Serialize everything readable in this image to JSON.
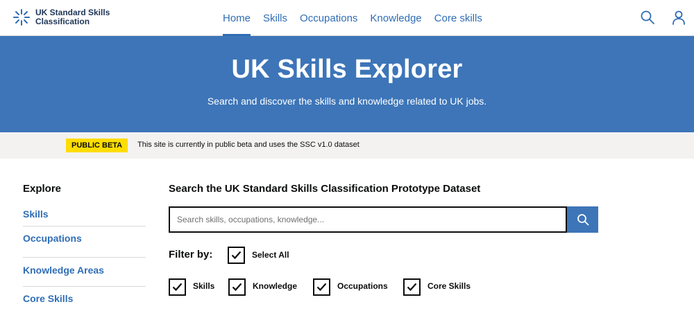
{
  "header": {
    "logo_text": "UK Standard Skills Classification",
    "nav": [
      {
        "label": "Home",
        "active": true
      },
      {
        "label": "Skills",
        "active": false
      },
      {
        "label": "Occupations",
        "active": false
      },
      {
        "label": "Knowledge",
        "active": false
      },
      {
        "label": "Core skills",
        "active": false
      }
    ],
    "icons": [
      "search-icon",
      "user-icon"
    ]
  },
  "hero": {
    "title": "UK Skills Explorer",
    "subtitle": "Search and discover the skills and knowledge related to UK jobs."
  },
  "beta": {
    "tag": "PUBLIC BETA",
    "text": "This site is currently in public beta and uses the SSC v1.0 dataset"
  },
  "sidebar": {
    "title": "Explore",
    "links": [
      "Skills",
      "Occupations",
      "Knowledge Areas",
      "Core Skills"
    ]
  },
  "main": {
    "title": "Search the UK Standard Skills Classification Prototype Dataset",
    "search": {
      "placeholder": "Search skills, occupations, knowledge...",
      "value": ""
    },
    "filter_label": "Filter by:",
    "select_all": {
      "label": "Select All",
      "checked": true
    },
    "filters": [
      {
        "label": "Skills",
        "checked": true
      },
      {
        "label": "Knowledge",
        "checked": true
      },
      {
        "label": "Occupations",
        "checked": true
      },
      {
        "label": "Core Skills",
        "checked": true
      }
    ]
  },
  "colors": {
    "brand_blue": "#3d75b8",
    "link_blue": "#2f6db5",
    "beta_yellow": "#ffdd00",
    "beta_bg": "#f3f2f1"
  }
}
